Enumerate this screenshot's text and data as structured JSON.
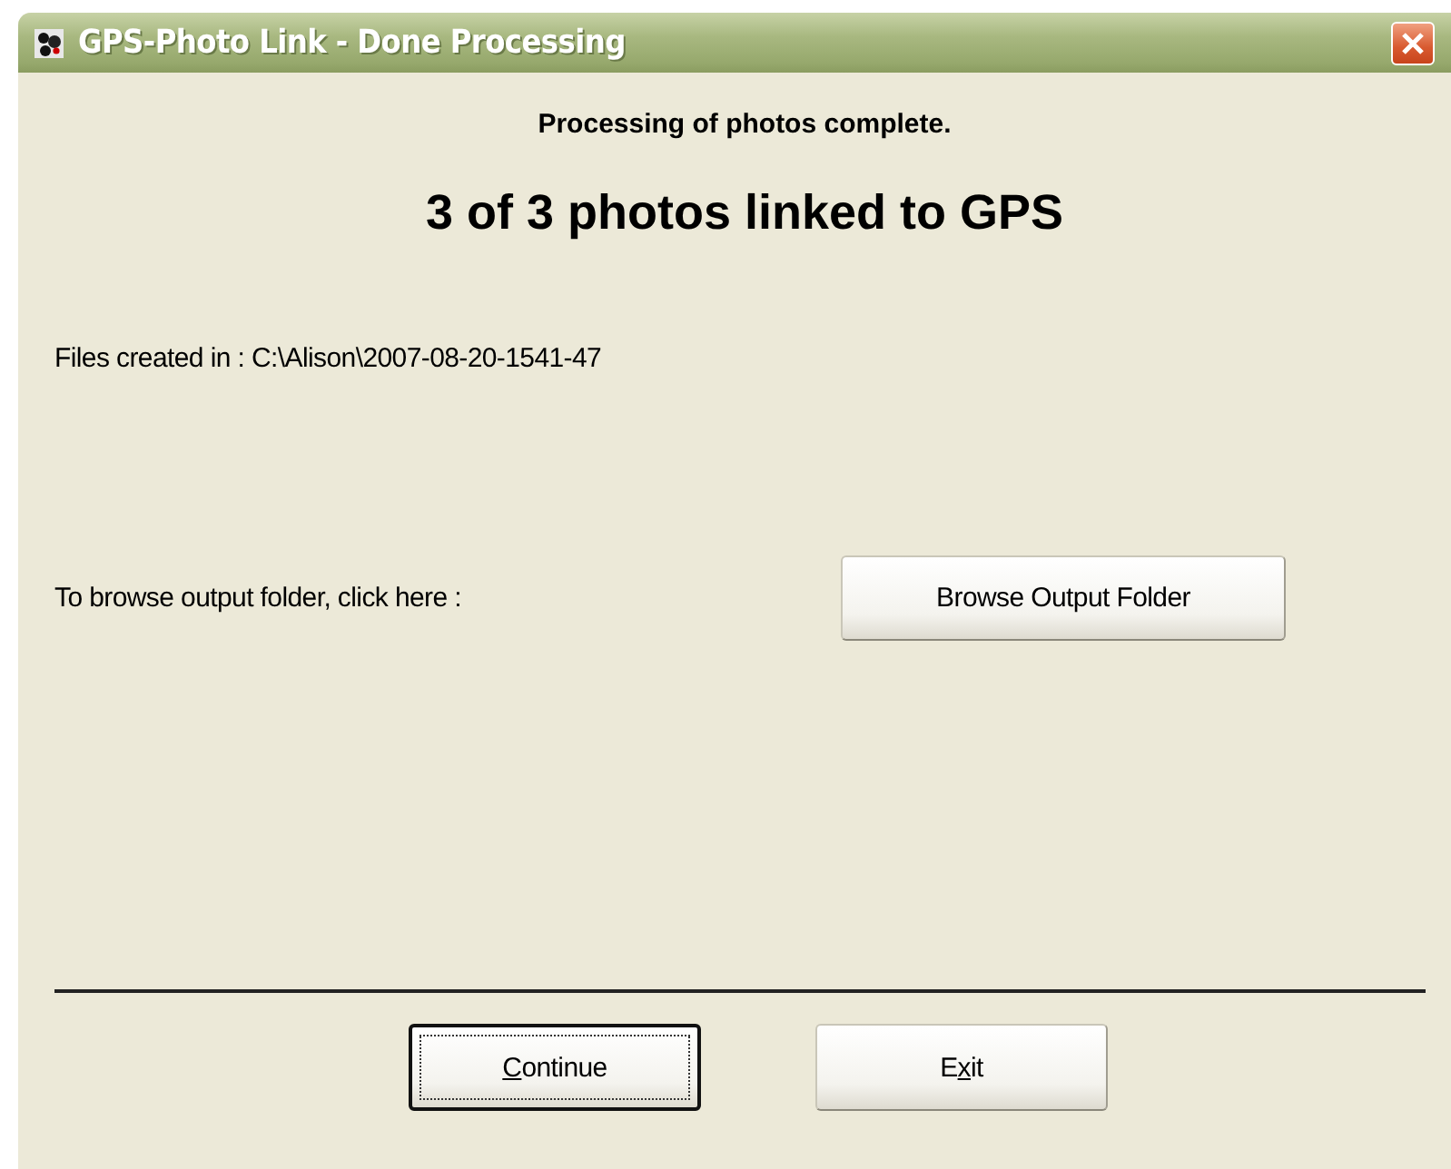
{
  "window": {
    "title": "GPS-Photo Link - Done Processing"
  },
  "status_line": "Processing of photos complete.",
  "result_heading": "3 of 3 photos linked to GPS",
  "files_created": "Files created in : C:\\Alison\\2007-08-20-1541-47",
  "browse": {
    "label": "To browse output folder, click here :",
    "button": "Browse Output Folder"
  },
  "buttons": [
    {
      "label": [
        {
          "text": "C",
          "underlined": true
        },
        {
          "text": "ontinue",
          "underlined": false
        }
      ],
      "focused": true
    },
    {
      "label": [
        {
          "text": "E",
          "underlined": false
        },
        {
          "text": "x",
          "underlined": true
        },
        {
          "text": "it",
          "underlined": false
        }
      ],
      "focused": false
    }
  ]
}
